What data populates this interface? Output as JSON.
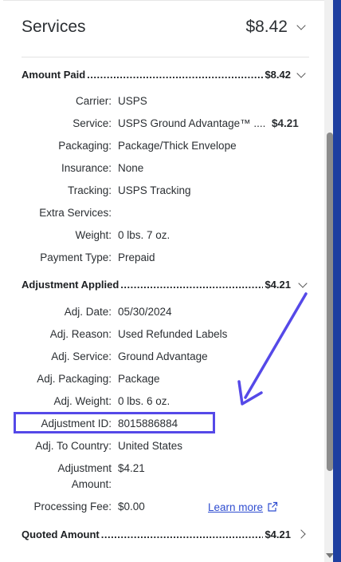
{
  "header": {
    "title": "Services",
    "total": "$8.42"
  },
  "amount_paid": {
    "label": "Amount Paid",
    "dots": "....................................................................................",
    "amount": "$8.42",
    "rows": [
      {
        "key": "Carrier:",
        "value": "USPS"
      },
      {
        "key": "Service:",
        "value": "USPS Ground Advantage™ ....",
        "price": "$4.21"
      },
      {
        "key": "Packaging:",
        "value": "Package/Thick Envelope"
      },
      {
        "key": "Insurance:",
        "value": "None"
      },
      {
        "key": "Tracking:",
        "value": "USPS Tracking"
      },
      {
        "key": "Extra Services:",
        "value": ""
      },
      {
        "key": "Weight:",
        "value": "0 lbs. 7 oz."
      },
      {
        "key": "Payment Type:",
        "value": "Prepaid"
      }
    ]
  },
  "adjustment": {
    "label": "Adjustment Applied",
    "dots": "....................................................................................",
    "amount": "$4.21",
    "rows": [
      {
        "key": "Adj. Date:",
        "value": "05/30/2024"
      },
      {
        "key": "Adj. Reason:",
        "value": "Used Refunded Labels"
      },
      {
        "key": "Adj. Service:",
        "value": "Ground Advantage"
      },
      {
        "key": "Adj. Packaging:",
        "value": "Package"
      },
      {
        "key": "Adj. Weight:",
        "value": "0 lbs. 6 oz."
      },
      {
        "key": "Adjustment ID:",
        "value": "8015886884"
      },
      {
        "key": "Adj. To Country:",
        "value": "United States"
      },
      {
        "key": "Adjustment",
        "key2": "Amount:",
        "value": "$4.21"
      },
      {
        "key": "Processing Fee:",
        "value": "$0.00"
      }
    ],
    "learn_more": "Learn more"
  },
  "quoted": {
    "label": "Quoted Amount",
    "dots": "....................................................................................",
    "amount": "$4.21"
  },
  "colors": {
    "accent": "#5549e8",
    "link": "#2f4dd0",
    "edge": "#1f3fa0"
  },
  "icons": [
    "chevron-down-icon",
    "chevron-right-icon",
    "external-link-icon",
    "annotation-arrow"
  ]
}
